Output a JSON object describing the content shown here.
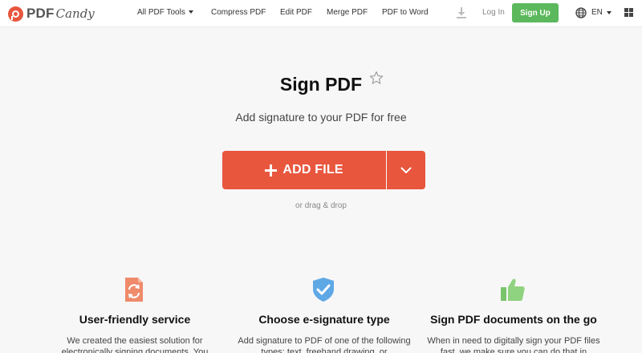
{
  "header": {
    "logo_pdf": "PDF",
    "logo_candy": "Candy",
    "nav": {
      "all_tools": "All PDF Tools",
      "compress": "Compress PDF",
      "edit": "Edit PDF",
      "merge": "Merge PDF",
      "to_word": "PDF to Word"
    },
    "login": "Log In",
    "signup": "Sign Up",
    "language": "EN",
    "colors": {
      "signup": "#5cb85c"
    }
  },
  "hero": {
    "title": "Sign PDF",
    "subtitle": "Add signature to your PDF for free",
    "add_file": "ADD FILE",
    "drag_drop": "or drag & drop",
    "colors": {
      "accent": "#e8563e"
    }
  },
  "features": [
    {
      "icon": "refresh-document-icon",
      "title": "User-friendly service",
      "text": "We created the easiest solution for electronically signing documents. You"
    },
    {
      "icon": "shield-check-icon",
      "title": "Choose e-signature type",
      "text": "Add signature to PDF of one of the following types: text, freehand drawing, or"
    },
    {
      "icon": "thumbs-up-icon",
      "title": "Sign PDF documents on the go",
      "text": "When in need to digitally sign your PDF files fast, we make sure you can do that in"
    }
  ]
}
